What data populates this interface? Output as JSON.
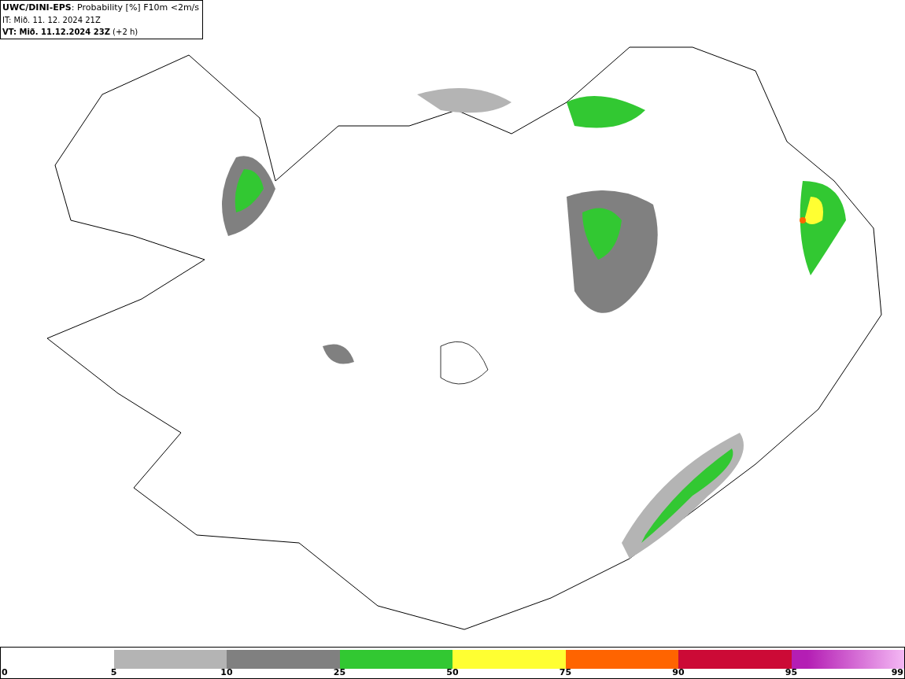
{
  "header": {
    "lines": [
      "**UWC/DINI-EPS**: Probability [%] F10m <2m/s",
      "IT: Mið. 11. 12. 2024 21Z",
      "**VT: Mið. 11.12.2024 23Z** (+2 h)"
    ]
  },
  "legend": {
    "start_label": "0",
    "bins": [
      {
        "label": "5"
      },
      {
        "label": "10",
        "color": "#b4b4b4"
      },
      {
        "label": "25",
        "color": "#808080"
      },
      {
        "label": "50",
        "color": "#32c832"
      },
      {
        "label": "75",
        "color": "#ffff32"
      },
      {
        "label": "90",
        "color": "#ff6400"
      },
      {
        "label": "95",
        "color": "#cc0a36"
      },
      {
        "label": "99",
        "color": "#b41eb4",
        "gradient": true
      }
    ]
  }
}
